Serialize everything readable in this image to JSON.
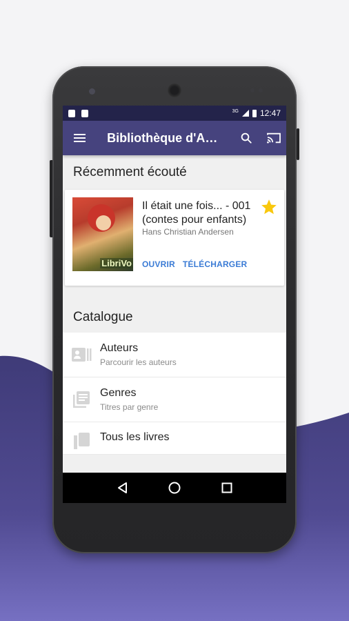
{
  "status_bar": {
    "network": "3G",
    "time": "12:47"
  },
  "app_bar": {
    "title": "Bibliothèque d'Aud..."
  },
  "recent": {
    "section_title": "Récemment écouté",
    "book": {
      "title": "Il était une fois... - 001 (contes pour enfants)",
      "author": "Hans Christian Andersen",
      "cover_label": "LibriVo",
      "starred": true,
      "open_label": "OUVRIR",
      "download_label": "TÉLÉCHARGER"
    }
  },
  "catalog": {
    "section_title": "Catalogue",
    "items": [
      {
        "title": "Auteurs",
        "subtitle": "Parcourir les auteurs",
        "icon": "contact-card-icon"
      },
      {
        "title": "Genres",
        "subtitle": "Titres par genre",
        "icon": "library-books-icon"
      },
      {
        "title": "Tous les livres",
        "subtitle": "",
        "icon": "books-icon"
      }
    ]
  },
  "colors": {
    "app_bar": "#46437e",
    "status_bar": "#23234a",
    "accent": "#3a7bd5",
    "star": "#f9c80e",
    "background_wave": "#4a4482"
  }
}
